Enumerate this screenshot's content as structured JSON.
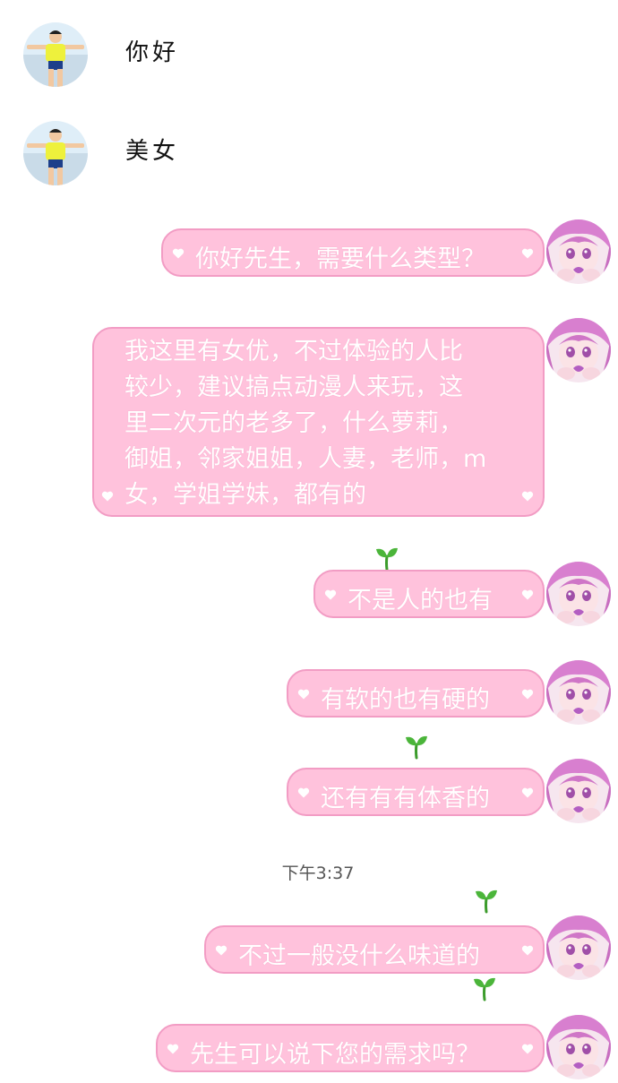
{
  "messages": {
    "in": [
      "你好",
      "美女"
    ],
    "out": [
      "你好先生，需要什么类型？",
      "我这里有女优，不过体验的人比",
      "较少，建议搞点动漫人来玩，这",
      "里二次元的老多了，什么萝莉，",
      "御姐，邻家姐姐，人妻，老师，m",
      "女，学姐学妹，都有的",
      "不是人的也有",
      "有软的也有硬的",
      "还有有有体香的",
      "不过一般没什么味道的",
      "先生可以说下您的需求吗？"
    ]
  },
  "timestamp": "下午3:37",
  "colors": {
    "bubble": "#ffc2dc",
    "border": "#f29cc4",
    "text": "#ffffff"
  },
  "icons": [
    "boy-avatar",
    "anime-girl-avatar",
    "heart-icon",
    "sprout-icon"
  ]
}
